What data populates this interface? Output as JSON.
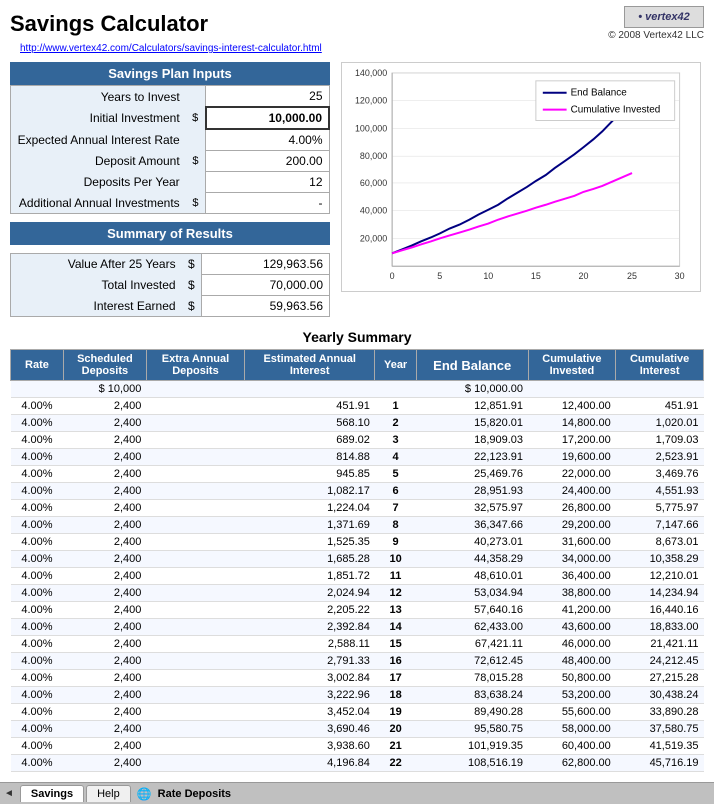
{
  "header": {
    "title": "Savings Calculator",
    "logo_text": "vertex42",
    "link_text": "http://www.vertex42.com/Calculators/savings-interest-calculator.html",
    "copyright": "© 2008 Vertex42 LLC"
  },
  "inputs": {
    "section_title": "Savings Plan Inputs",
    "fields": [
      {
        "label": "Years to Invest",
        "dollar": "",
        "value": "25"
      },
      {
        "label": "Initial Investment",
        "dollar": "$",
        "value": "10,000.00"
      },
      {
        "label": "Expected Annual Interest Rate",
        "dollar": "",
        "value": "4.00%"
      },
      {
        "label": "Deposit Amount",
        "dollar": "$",
        "value": "200.00"
      },
      {
        "label": "Deposits Per Year",
        "dollar": "",
        "value": "12"
      },
      {
        "label": "Additional Annual Investments",
        "dollar": "$",
        "value": "-"
      }
    ]
  },
  "results": {
    "section_title": "Summary of Results",
    "fields": [
      {
        "label": "Value After 25 Years",
        "dollar": "$",
        "value": "129,963.56"
      },
      {
        "label": "Total Invested",
        "dollar": "$",
        "value": "70,000.00"
      },
      {
        "label": "Interest Earned",
        "dollar": "$",
        "value": "59,963.56"
      }
    ]
  },
  "chart": {
    "y_labels": [
      "140,000",
      "120,000",
      "100,000",
      "80,000",
      "60,000",
      "40,000",
      "20,000",
      ""
    ],
    "x_labels": [
      "0",
      "5",
      "10",
      "15",
      "20",
      "25",
      "30"
    ],
    "legend": [
      {
        "label": "End Balance",
        "color": "#000080"
      },
      {
        "label": "Cumulative Invested",
        "color": "#ff00ff"
      }
    ]
  },
  "yearly_summary": {
    "title": "Yearly Summary",
    "headers": [
      "Rate",
      "Scheduled\nDeposits",
      "Extra Annual\nDeposits",
      "Estimated Annual\nInterest",
      "Year",
      "End Balance",
      "Cumulative\nInvested",
      "Cumulative\nInterest"
    ],
    "initial_row": {
      "rate": "",
      "scheduled": "$ 10,000",
      "extra": "",
      "interest": "",
      "year": "",
      "end_balance": "$ 10,000.00",
      "cum_invested": "",
      "cum_interest": ""
    },
    "rows": [
      {
        "rate": "4.00%",
        "scheduled": "2,400",
        "extra": "",
        "interest": "451.91",
        "year": "1",
        "end_balance": "12,851.91",
        "cum_invested": "12,400.00",
        "cum_interest": "451.91"
      },
      {
        "rate": "4.00%",
        "scheduled": "2,400",
        "extra": "",
        "interest": "568.10",
        "year": "2",
        "end_balance": "15,820.01",
        "cum_invested": "14,800.00",
        "cum_interest": "1,020.01"
      },
      {
        "rate": "4.00%",
        "scheduled": "2,400",
        "extra": "",
        "interest": "689.02",
        "year": "3",
        "end_balance": "18,909.03",
        "cum_invested": "17,200.00",
        "cum_interest": "1,709.03"
      },
      {
        "rate": "4.00%",
        "scheduled": "2,400",
        "extra": "",
        "interest": "814.88",
        "year": "4",
        "end_balance": "22,123.91",
        "cum_invested": "19,600.00",
        "cum_interest": "2,523.91"
      },
      {
        "rate": "4.00%",
        "scheduled": "2,400",
        "extra": "",
        "interest": "945.85",
        "year": "5",
        "end_balance": "25,469.76",
        "cum_invested": "22,000.00",
        "cum_interest": "3,469.76"
      },
      {
        "rate": "4.00%",
        "scheduled": "2,400",
        "extra": "",
        "interest": "1,082.17",
        "year": "6",
        "end_balance": "28,951.93",
        "cum_invested": "24,400.00",
        "cum_interest": "4,551.93"
      },
      {
        "rate": "4.00%",
        "scheduled": "2,400",
        "extra": "",
        "interest": "1,224.04",
        "year": "7",
        "end_balance": "32,575.97",
        "cum_invested": "26,800.00",
        "cum_interest": "5,775.97"
      },
      {
        "rate": "4.00%",
        "scheduled": "2,400",
        "extra": "",
        "interest": "1,371.69",
        "year": "8",
        "end_balance": "36,347.66",
        "cum_invested": "29,200.00",
        "cum_interest": "7,147.66"
      },
      {
        "rate": "4.00%",
        "scheduled": "2,400",
        "extra": "",
        "interest": "1,525.35",
        "year": "9",
        "end_balance": "40,273.01",
        "cum_invested": "31,600.00",
        "cum_interest": "8,673.01"
      },
      {
        "rate": "4.00%",
        "scheduled": "2,400",
        "extra": "",
        "interest": "1,685.28",
        "year": "10",
        "end_balance": "44,358.29",
        "cum_invested": "34,000.00",
        "cum_interest": "10,358.29"
      },
      {
        "rate": "4.00%",
        "scheduled": "2,400",
        "extra": "",
        "interest": "1,851.72",
        "year": "11",
        "end_balance": "48,610.01",
        "cum_invested": "36,400.00",
        "cum_interest": "12,210.01"
      },
      {
        "rate": "4.00%",
        "scheduled": "2,400",
        "extra": "",
        "interest": "2,024.94",
        "year": "12",
        "end_balance": "53,034.94",
        "cum_invested": "38,800.00",
        "cum_interest": "14,234.94"
      },
      {
        "rate": "4.00%",
        "scheduled": "2,400",
        "extra": "",
        "interest": "2,205.22",
        "year": "13",
        "end_balance": "57,640.16",
        "cum_invested": "41,200.00",
        "cum_interest": "16,440.16"
      },
      {
        "rate": "4.00%",
        "scheduled": "2,400",
        "extra": "",
        "interest": "2,392.84",
        "year": "14",
        "end_balance": "62,433.00",
        "cum_invested": "43,600.00",
        "cum_interest": "18,833.00"
      },
      {
        "rate": "4.00%",
        "scheduled": "2,400",
        "extra": "",
        "interest": "2,588.11",
        "year": "15",
        "end_balance": "67,421.11",
        "cum_invested": "46,000.00",
        "cum_interest": "21,421.11"
      },
      {
        "rate": "4.00%",
        "scheduled": "2,400",
        "extra": "",
        "interest": "2,791.33",
        "year": "16",
        "end_balance": "72,612.45",
        "cum_invested": "48,400.00",
        "cum_interest": "24,212.45"
      },
      {
        "rate": "4.00%",
        "scheduled": "2,400",
        "extra": "",
        "interest": "3,002.84",
        "year": "17",
        "end_balance": "78,015.28",
        "cum_invested": "50,800.00",
        "cum_interest": "27,215.28"
      },
      {
        "rate": "4.00%",
        "scheduled": "2,400",
        "extra": "",
        "interest": "3,222.96",
        "year": "18",
        "end_balance": "83,638.24",
        "cum_invested": "53,200.00",
        "cum_interest": "30,438.24"
      },
      {
        "rate": "4.00%",
        "scheduled": "2,400",
        "extra": "",
        "interest": "3,452.04",
        "year": "19",
        "end_balance": "89,490.28",
        "cum_invested": "55,600.00",
        "cum_interest": "33,890.28"
      },
      {
        "rate": "4.00%",
        "scheduled": "2,400",
        "extra": "",
        "interest": "3,690.46",
        "year": "20",
        "end_balance": "95,580.75",
        "cum_invested": "58,000.00",
        "cum_interest": "37,580.75"
      },
      {
        "rate": "4.00%",
        "scheduled": "2,400",
        "extra": "",
        "interest": "3,938.60",
        "year": "21",
        "end_balance": "101,919.35",
        "cum_invested": "60,400.00",
        "cum_interest": "41,519.35"
      },
      {
        "rate": "4.00%",
        "scheduled": "2,400",
        "extra": "",
        "interest": "4,196.84",
        "year": "22",
        "end_balance": "108,516.19",
        "cum_invested": "62,800.00",
        "cum_interest": "45,716.19"
      }
    ]
  },
  "tabs": {
    "arrow_left": "◄",
    "items": [
      {
        "label": "Savings",
        "active": true
      },
      {
        "label": "Help",
        "active": false
      }
    ],
    "tab_icon": "🌐",
    "rate_deposits": "Rate Deposits"
  }
}
